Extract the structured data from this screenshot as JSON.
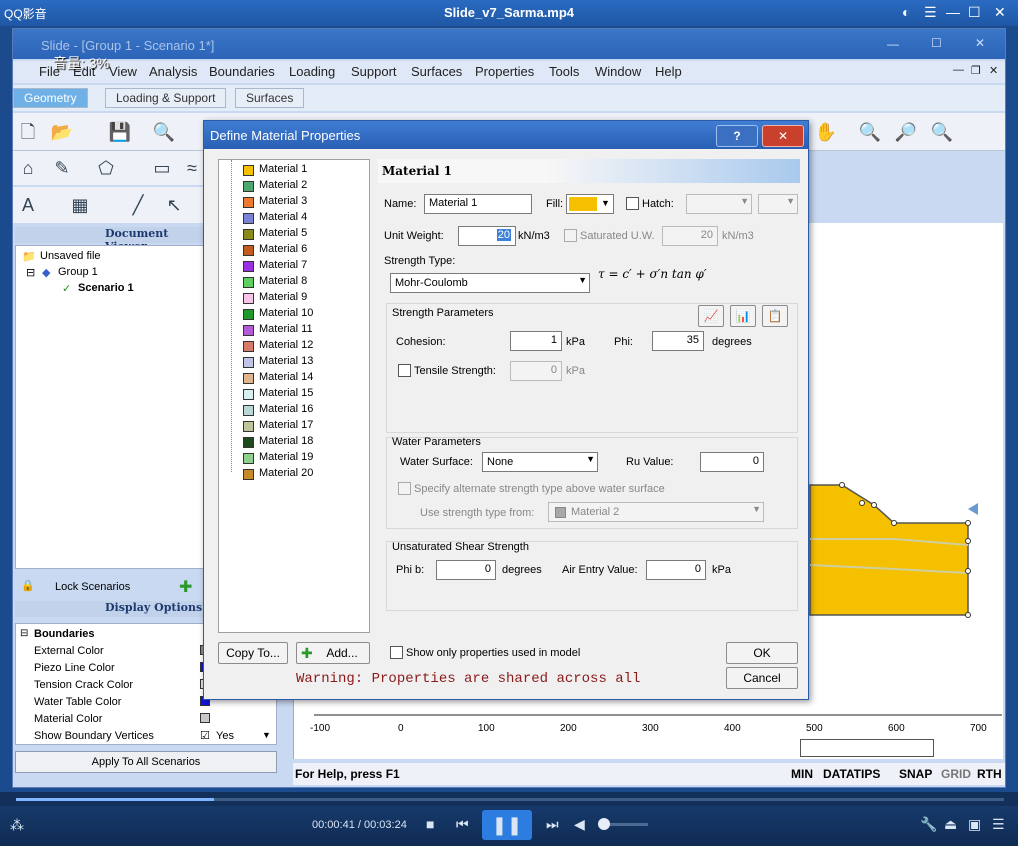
{
  "player": {
    "app_name": "QQ影音",
    "file_title": "Slide_v7_Sarma.mp4",
    "volume_label": "音量: 3%",
    "time": "00:00:41 / 00:03:24",
    "progress": 0.2
  },
  "app": {
    "title": "Slide - [Group 1 - Scenario 1*]",
    "menu": [
      "File",
      "Edit",
      "View",
      "Analysis",
      "Boundaries",
      "Loading",
      "Support",
      "Surfaces",
      "Properties",
      "Tools",
      "Window",
      "Help"
    ],
    "workflow_tabs": [
      "Geometry",
      "Loading & Support",
      "Surfaces"
    ],
    "document_viewer": {
      "header": "Document Viewer",
      "items": [
        "Unsaved file",
        "Group 1",
        "Scenario 1"
      ]
    },
    "lock_scenarios": "Lock Scenarios",
    "display_options": {
      "header": "Display Options",
      "section": "Boundaries",
      "rows": [
        "External Color",
        "Piezo Line Color",
        "Tension Crack Color",
        "Water Table Color",
        "Material Color",
        "Show Boundary Vertices"
      ],
      "show_vertices_value": "Yes"
    },
    "apply_all": "Apply To All Scenarios",
    "axis_ticks": [
      "-100",
      "0",
      "100",
      "200",
      "300",
      "400",
      "500",
      "600",
      "700"
    ],
    "status": {
      "help": "For Help, press F1",
      "min": "MIN",
      "datatips": "DATATIPS",
      "snap": "SNAP",
      "grid": "GRID",
      "rth": "RTH"
    }
  },
  "dialog": {
    "title": "Define Material Properties",
    "help_label": "?",
    "close_label": "✕",
    "materials": [
      {
        "name": "Material 1",
        "color": "#f5c000"
      },
      {
        "name": "Material 2",
        "color": "#4da870"
      },
      {
        "name": "Material 3",
        "color": "#ef7a2d"
      },
      {
        "name": "Material 4",
        "color": "#7a82d6"
      },
      {
        "name": "Material 5",
        "color": "#8a8a18"
      },
      {
        "name": "Material 6",
        "color": "#c45a1e"
      },
      {
        "name": "Material 7",
        "color": "#9a30e0"
      },
      {
        "name": "Material 8",
        "color": "#5fcf5f"
      },
      {
        "name": "Material 9",
        "color": "#f5c4e8"
      },
      {
        "name": "Material 10",
        "color": "#1f9a2a"
      },
      {
        "name": "Material 11",
        "color": "#b45ad8"
      },
      {
        "name": "Material 12",
        "color": "#d87a6a"
      },
      {
        "name": "Material 13",
        "color": "#c0c4e8"
      },
      {
        "name": "Material 14",
        "color": "#e0b48c"
      },
      {
        "name": "Material 15",
        "color": "#d8f0f0"
      },
      {
        "name": "Material 16",
        "color": "#b8d8d8"
      },
      {
        "name": "Material 17",
        "color": "#c0c49a"
      },
      {
        "name": "Material 18",
        "color": "#1c4a1c"
      },
      {
        "name": "Material 19",
        "color": "#8ed08e"
      },
      {
        "name": "Material 20",
        "color": "#c88a28"
      }
    ],
    "header": "Material 1",
    "name_label": "Name:",
    "name_value": "Material 1",
    "fill_label": "Fill:",
    "fill_color": "#f5c000",
    "hatch_label": "Hatch:",
    "unit_weight_label": "Unit Weight:",
    "unit_weight_value": "20",
    "unit_weight_unit": "kN/m3",
    "sat_uw_label": "Saturated U.W.",
    "sat_uw_value": "20",
    "sat_uw_unit": "kN/m3",
    "strength_type_label": "Strength Type:",
    "strength_type_value": "Mohr-Coulomb",
    "formula": "τ = c′ + σ′n tan φ′",
    "strength_params_label": "Strength Parameters",
    "cohesion_label": "Cohesion:",
    "cohesion_value": "1",
    "cohesion_unit": "kPa",
    "phi_label": "Phi:",
    "phi_value": "35",
    "phi_unit": "degrees",
    "tensile_label": "Tensile Strength:",
    "tensile_value": "0",
    "tensile_unit": "kPa",
    "water_params_label": "Water Parameters",
    "water_surface_label": "Water Surface:",
    "water_surface_value": "None",
    "ru_label": "Ru Value:",
    "ru_value": "0",
    "alt_strength_label": "Specify alternate strength type above water surface",
    "use_from_label": "Use strength type from:",
    "use_from_value": "Material 2",
    "unsat_label": "Unsaturated Shear Strength",
    "phib_label": "Phi b:",
    "phib_value": "0",
    "phib_unit": "degrees",
    "air_entry_label": "Air Entry Value:",
    "air_entry_value": "0",
    "air_entry_unit": "kPa",
    "copy_to": "Copy To...",
    "add": "Add...",
    "show_only_label": "Show only properties used in model",
    "ok": "OK",
    "cancel": "Cancel",
    "warning": "Warning: Properties are shared across all"
  }
}
